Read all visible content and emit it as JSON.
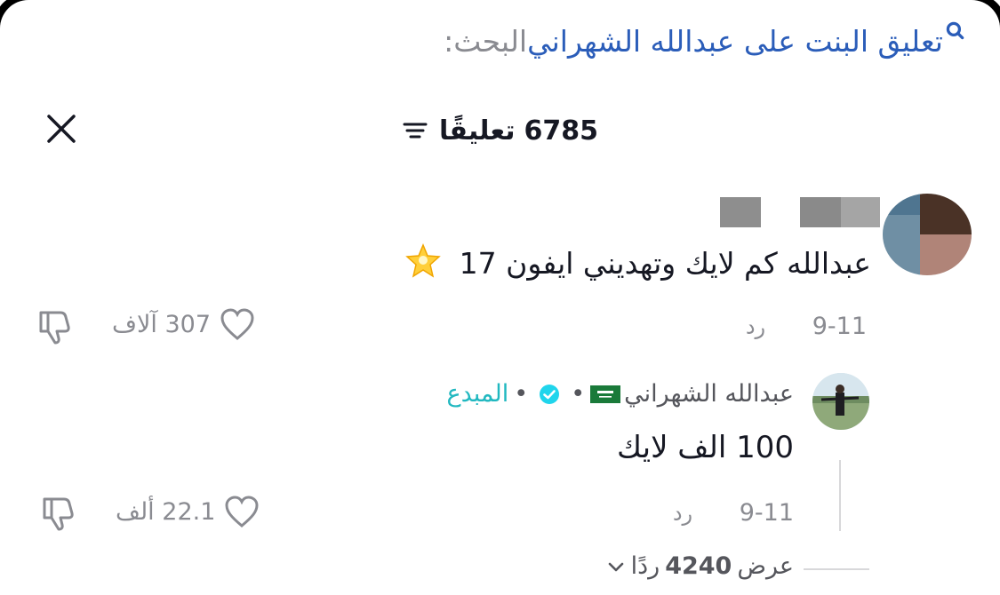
{
  "search": {
    "label": "البحث:",
    "query": "تعليق البنت على عبدالله الشهراني",
    "icon": "search-icon"
  },
  "header": {
    "comment_count": "6785",
    "comments_label": "تعليقًا",
    "sort_icon": "sort-icon",
    "close_icon": "close-icon"
  },
  "comments": [
    {
      "text": "عبدالله كم لايك وتهديني ايفون 17",
      "emoji": "star-icon",
      "date": "9-11",
      "reply_label": "رد",
      "likes": "307 آلاف"
    }
  ],
  "reply": {
    "author": "عبدالله الشهراني",
    "flag": "saudi-flag-icon",
    "separator": "•",
    "creator_label": "المبدع",
    "text": "100 الف لايك",
    "date": "9-11",
    "reply_label": "رد",
    "likes": "22.1 ألف"
  },
  "view_replies": {
    "prefix": "عرض",
    "count": "4240",
    "suffix": "ردًا"
  },
  "colors": {
    "search_query": "#2b5db9",
    "creator_badge": "#21b8c0",
    "muted": "#8a8b91",
    "text": "#161823"
  }
}
